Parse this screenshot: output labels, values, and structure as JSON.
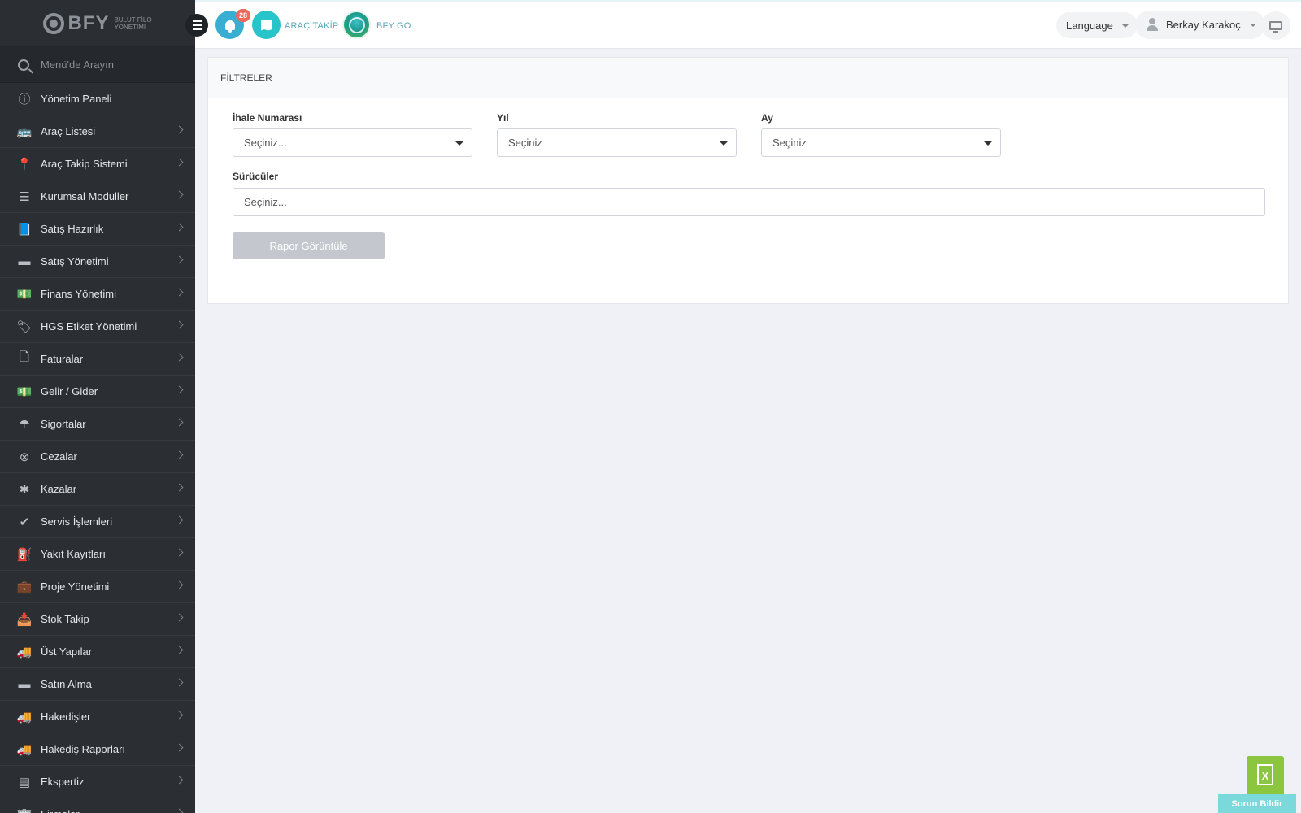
{
  "brand": {
    "name": "BFY",
    "subtitle_line1": "BULUT FİLO",
    "subtitle_line2": "YÖNETİMİ"
  },
  "sidebar": {
    "search_placeholder": "Menü'de Arayın",
    "items": [
      {
        "label": "Yönetim Paneli",
        "icon": "dashboard-icon",
        "glyph": "ⓘ",
        "has_submenu": false
      },
      {
        "label": "Araç Listesi",
        "icon": "bus-icon",
        "glyph": "🚌",
        "has_submenu": true
      },
      {
        "label": "Araç Takip Sistemi",
        "icon": "map-marker-icon",
        "glyph": "📍",
        "has_submenu": true
      },
      {
        "label": "Kurumsal Modüller",
        "icon": "server-icon",
        "glyph": "☰",
        "has_submenu": true
      },
      {
        "label": "Satış Hazırlık",
        "icon": "book-icon",
        "glyph": "📘",
        "has_submenu": true
      },
      {
        "label": "Satış Yönetimi",
        "icon": "credit-card-icon",
        "glyph": "▬",
        "has_submenu": true
      },
      {
        "label": "Finans Yönetimi",
        "icon": "money-icon",
        "glyph": "💵",
        "has_submenu": true
      },
      {
        "label": "HGS Etiket Yönetimi",
        "icon": "tag-icon",
        "glyph": "🏷",
        "has_submenu": true
      },
      {
        "label": "Faturalar",
        "icon": "file-icon",
        "glyph": "🗋",
        "has_submenu": true
      },
      {
        "label": "Gelir / Gider",
        "icon": "money-icon",
        "glyph": "💵",
        "has_submenu": true
      },
      {
        "label": "Sigortalar",
        "icon": "umbrella-icon",
        "glyph": "☂",
        "has_submenu": true
      },
      {
        "label": "Cezalar",
        "icon": "times-circle-icon",
        "glyph": "⊗",
        "has_submenu": true
      },
      {
        "label": "Kazalar",
        "icon": "car-crash-icon",
        "glyph": "✱",
        "has_submenu": true
      },
      {
        "label": "Servis İşlemleri",
        "icon": "check-circle-icon",
        "glyph": "✔",
        "has_submenu": true
      },
      {
        "label": "Yakıt Kayıtları",
        "icon": "gas-pump-icon",
        "glyph": "⛽",
        "has_submenu": true
      },
      {
        "label": "Proje Yönetimi",
        "icon": "briefcase-icon",
        "glyph": "💼",
        "has_submenu": true
      },
      {
        "label": "Stok Takip",
        "icon": "inbox-icon",
        "glyph": "📥",
        "has_submenu": true
      },
      {
        "label": "Üst Yapılar",
        "icon": "truck-icon",
        "glyph": "🚚",
        "has_submenu": true
      },
      {
        "label": "Satın Alma",
        "icon": "credit-card-icon",
        "glyph": "▬",
        "has_submenu": true
      },
      {
        "label": "Hakedişler",
        "icon": "truck-icon",
        "glyph": "🚚",
        "has_submenu": true
      },
      {
        "label": "Hakediş Raporları",
        "icon": "truck-icon",
        "glyph": "🚚",
        "has_submenu": true
      },
      {
        "label": "Ekspertiz",
        "icon": "list-alt-icon",
        "glyph": "▤",
        "has_submenu": true
      },
      {
        "label": "Firmalar",
        "icon": "building-icon",
        "glyph": "🏢",
        "has_submenu": true
      }
    ]
  },
  "header": {
    "notification_count": "28",
    "arac_takip_label": "ARAÇ TAKİP",
    "bfy_go_label": "BFY GO",
    "language_label": "Language",
    "user_name": "Berkay Karakoç"
  },
  "filters": {
    "title": "FİLTRELER",
    "ihale_label": "İhale Numarası",
    "ihale_placeholder": "Seçiniz...",
    "yil_label": "Yıl",
    "yil_value": "Seçiniz",
    "ay_label": "Ay",
    "ay_value": "Seçiniz",
    "suruculer_label": "Sürücüler",
    "suruculer_placeholder": "Seçiniz...",
    "report_button": "Rapor Görüntüle"
  },
  "floating": {
    "excel_glyph": "X",
    "report_issue": "Sorun Bildir"
  },
  "colors": {
    "sidebar_bg": "#2b2f33",
    "accent_teal": "#27c4c9",
    "accent_blue": "#3aaed2",
    "badge_red": "#f0675c",
    "excel_green": "#8cc63f"
  }
}
